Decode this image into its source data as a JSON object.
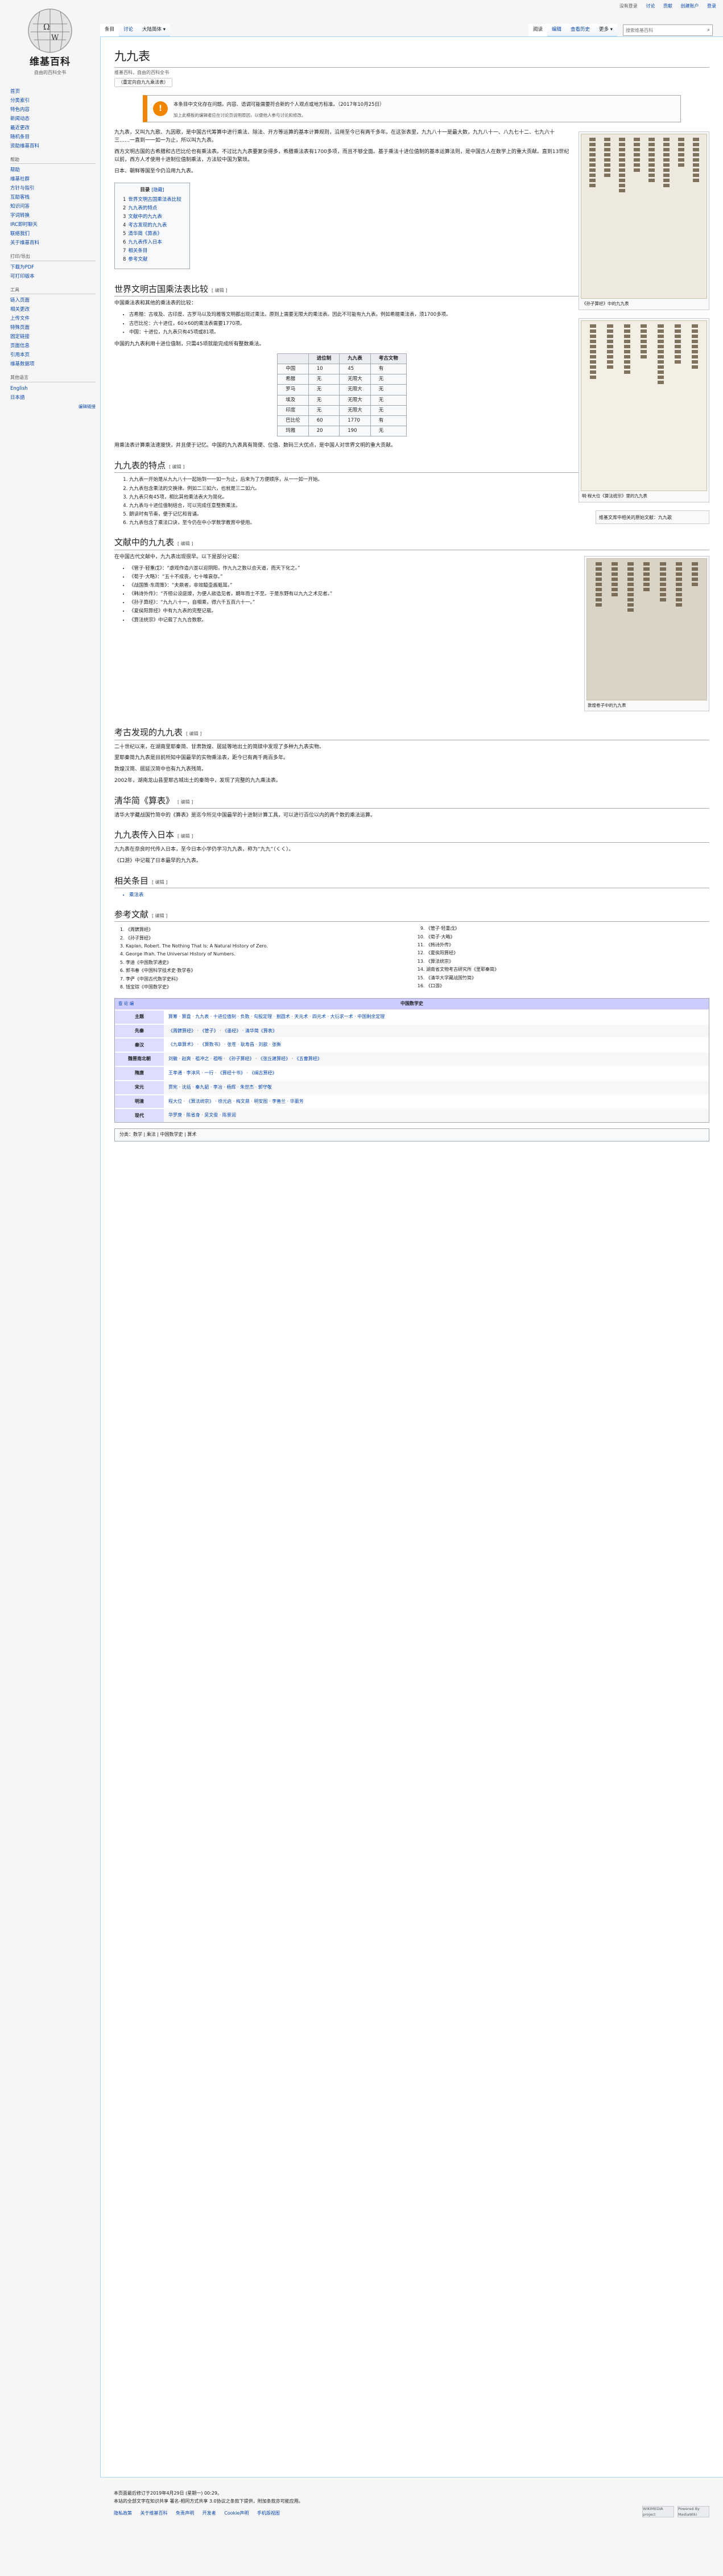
{
  "site": {
    "name": "维基百科",
    "tagline": "自由的百科全书"
  },
  "personal": [
    "没有登录",
    "讨论",
    "贡献",
    "创建账户",
    "登录"
  ],
  "nav": {
    "main": [
      "首页",
      "分类索引",
      "特色内容",
      "新闻动态",
      "最近更改",
      "随机条目",
      "资助维基百科"
    ],
    "help_title": "帮助",
    "help": [
      "帮助",
      "维基社群",
      "方针与指引",
      "互助客栈",
      "知识问答",
      "字词转换",
      "IRC即时聊天",
      "联络我们",
      "关于维基百科"
    ],
    "print_title": "打印/导出",
    "print": [
      "下载为PDF",
      "可打印版本"
    ],
    "tools_title": "工具",
    "tools": [
      "链入页面",
      "相关更改",
      "上传文件",
      "特殊页面",
      "固定链接",
      "页面信息",
      "引用本页",
      "维基数据项"
    ],
    "lang_title": "其他语言",
    "lang": [
      "English",
      "日本語"
    ],
    "lang_edit": "编辑链接"
  },
  "tabs": {
    "left": [
      "条目",
      "讨论",
      "大陆简体"
    ],
    "right": [
      "阅读",
      "编辑",
      "查看历史",
      "更多"
    ]
  },
  "search": {
    "placeholder": "搜索维基百科"
  },
  "article": {
    "title": "九九表",
    "from": "维基百科，自由的百科全书",
    "variant": "（重定向自九九乘法表）",
    "notice": "本条目中文化存在问题。内容、语调可能需要符合新的个人观点或地方标准。（2017年10月25日）",
    "notice2": "加上此模板的编辑者应在讨论页说明原因，以便他人参与讨论和修改。",
    "intro": "九九表，又叫九九歌、九因歌，是中国古代筹算中进行乘法、除法、开方等运算的基本计算规则，沿用至今已有两千多年。在这张表里，九九八十一是最大数，九九八十一、八九七十二、七九六十三……一直到一一如一为止，所以叫九九表。",
    "intro2": "西方文明古国的古希腊和古巴比伦也有乘法表。不过比九九表要复杂得多，希腊乘法表有1700多项，而且不够全面。基于乘法十进位值制的基本运算法则，是中国古人在数学上的重大贡献。直到13世纪以前，西方人才使用十进制位值制乘法，方法较中国为繁琐。",
    "intro3": "日本、朝鲜等国至今仍沿用九九表。"
  },
  "toc": {
    "title": "目录",
    "hide": "[隐藏]",
    "items": [
      {
        "n": "1",
        "t": "世界文明古国乘法表比较"
      },
      {
        "n": "2",
        "t": "九九表的特点"
      },
      {
        "n": "3",
        "t": "文献中的九九表"
      },
      {
        "n": "4",
        "t": "考古发现的九九表"
      },
      {
        "n": "5",
        "t": "清华简《算表》"
      },
      {
        "n": "6",
        "t": "九九表传入日本"
      },
      {
        "n": "7",
        "t": "相关条目"
      },
      {
        "n": "8",
        "t": "参考文献"
      }
    ]
  },
  "edit": "[ 编辑 ]",
  "figs": {
    "f1": "《孙子算经》中的九九表",
    "f2": "明·程大位《算法统宗》里的九九表",
    "f3": "敦煌卷子中的九九表",
    "f4": "维基文库中相关的原始文献：九九歌"
  },
  "s1": {
    "title": "世界文明古国乘法表比较",
    "p1": "中国乘法表和其他的乘法表的比较：",
    "bullets": [
      "古希腊：古埃及、古印度、古罗马以及玛雅等文明都出现过乘法。原则上需要无限大的乘法表。因此不可能有九九表。例如希腊乘法表，须1700多项。",
      "古巴比伦：六十进位，60×60的乘法表需要1770项。",
      "中国：十进位，九九表只有45项或81项。"
    ],
    "p2": "中国的九九表利用十进位值制，只需45项就能完成所有整数乘法。",
    "table": {
      "headers": [
        "",
        "进位制",
        "九九表",
        "考古文物"
      ],
      "rows": [
        [
          "中国",
          "10",
          "45",
          "有"
        ],
        [
          "希腊",
          "无",
          "无限大",
          "无"
        ],
        [
          "罗马",
          "无",
          "无限大",
          "无"
        ],
        [
          "埃及",
          "无",
          "无限大",
          "无"
        ],
        [
          "印度",
          "无",
          "无限大",
          "无"
        ],
        [
          "巴比伦",
          "60",
          "1770",
          "有"
        ],
        [
          "玛雅",
          "20",
          "190",
          "无"
        ]
      ]
    },
    "p3": "用乘法表计算乘法速度快，并且便于记忆。中国的九九表具有简便、位值、数码三大优点，是中国人对世界文明的重大贡献。"
  },
  "s2": {
    "title": "九九表的特点",
    "items": [
      "九九表一开始是从九九八十一起始到一一如一为止，后来为了方便顺序，从一一如一开始。",
      "九九表包含乘法的交换律。例如二三如六，也就是三二如六。",
      "九九表只有45项，相比其他乘法表大为简化。",
      "九九表与十进位值制结合，可以完成任意整数乘法。",
      "朗读时有节奏，便于记忆和背诵。",
      "九九表包含了乘法口诀，至今仍在中小学数学教育中使用。"
    ]
  },
  "s3": {
    "title": "文献中的九九表",
    "p1": "在中国古代文献中，九九表出现很早。以下是部分记载：",
    "quotes": [
      "《管子·轻重戊》：“虙戏作造六峜以迎阴阳，作九九之数以合天道，而天下化之。”",
      "《荀子·大略》：“五十不成丧，七十唯衰存。”",
      "《战国策·东周策》：“夫鼎者，非效醯壶酱甀耳。”",
      "《韩诗外传》：“齐桓公设庭燎，为便人欲造见者，期年而士不至。于是东野有以九九之术见者。”",
      "《孙子算经》：“九九八十一，自相乘，得六千五百六十一。”",
      "《夏侯阳算经》中有九九表的完整记载。",
      "《算法统宗》中记载了九九合数歌。"
    ]
  },
  "s4": {
    "title": "考古发现的九九表",
    "p1": "二十世纪以来，在湖南里耶秦简、甘肃敦煌、居延等地出土的简牍中发现了多种九九表实物。",
    "p2": "里耶秦简九九表是目前所知中国最早的实物乘法表，距今已有两千两百多年。",
    "p3": "敦煌汉简、居延汉简中也有九九表残简。",
    "p4": "2002年，湖南龙山县里耶古城出土的秦简中，发现了完整的九九乘法表。"
  },
  "s5": {
    "title": "清华简《算表》",
    "p1": "清华大学藏战国竹简中的《算表》是迄今所见中国最早的十进制计算工具，可以进行百位以内的两个数的乘法运算。"
  },
  "s6": {
    "title": "九九表传入日本",
    "p1": "九九表在奈良时代传入日本，至今日本小学仍学习九九表，称为“九九”（くく）。",
    "p2": "《口游》中记载了日本最早的九九表。"
  },
  "s7": {
    "title": "相关条目",
    "items": [
      "乘法表"
    ]
  },
  "s8": {
    "title": "参考文献",
    "refs": [
      "《周髀算经》",
      "《孙子算经》",
      "Kaplan, Robert. The Nothing That Is: A Natural History of Zero.",
      "George Ifrah. The Universal History of Numbers.",
      "李迪《中国数学通史》",
      "郭书春《中国科学技术史·数学卷》",
      "李俨《中国古代数学史料》",
      "钱宝琮《中国数学史》",
      "《管子·轻重戊》",
      "《荀子·大略》",
      "《韩诗外传》",
      "《夏侯阳算经》",
      "《算法统宗》",
      "湖南省文物考古研究所《里耶秦简》",
      "《清华大学藏战国竹简》",
      "《口游》"
    ]
  },
  "navbox": {
    "title": "中国数学史",
    "vte": "查 论 编",
    "rows": [
      {
        "g": "主题",
        "l": "算筹 · 算盘 · 九九表 · 十进位值制 · 负数 · 勾股定理 · 割圆术 · 天元术 · 四元术 · 大衍求一术 · 中国剩余定理"
      },
      {
        "g": "先秦",
        "l": "《周髀算经》 · 《管子》 · 《墨经》 · 清华简《算表》"
      },
      {
        "g": "秦汉",
        "l": "《九章算术》 · 《算数书》 · 张苍 · 耿寿昌 · 刘歆 · 张衡"
      },
      {
        "g": "魏晋南北朝",
        "l": "刘徽 · 赵爽 · 祖冲之 · 祖暅 · 《孙子算经》 · 《张丘建算经》 · 《五曹算经》"
      },
      {
        "g": "隋唐",
        "l": "王孝通 · 李淳风 · 一行 · 《算经十书》 · 《缉古算经》"
      },
      {
        "g": "宋元",
        "l": "贾宪 · 沈括 · 秦九韶 · 李冶 · 杨辉 · 朱世杰 · 郭守敬"
      },
      {
        "g": "明清",
        "l": "程大位 · 《算法统宗》 · 徐光启 · 梅文鼎 · 明安图 · 李善兰 · 华蘅芳"
      },
      {
        "g": "现代",
        "l": "华罗庚 · 陈省身 · 吴文俊 · 陈景润"
      }
    ]
  },
  "categories": "分类：数学 | 乘法 | 中国数学史 | 算术",
  "footer": {
    "modified": "本页面最后修订于2019年4月29日 (星期一) 00:29。",
    "license": "本站的全部文字在知识共享 署名-相同方式共享 3.0协议之条款下提供，附加条款亦可能应用。",
    "links": [
      "隐私政策",
      "关于维基百科",
      "免责声明",
      "开发者",
      "Cookie声明",
      "手机版视图"
    ],
    "badge1": "WIKIMEDIA project",
    "badge2": "Powered By MediaWiki"
  }
}
